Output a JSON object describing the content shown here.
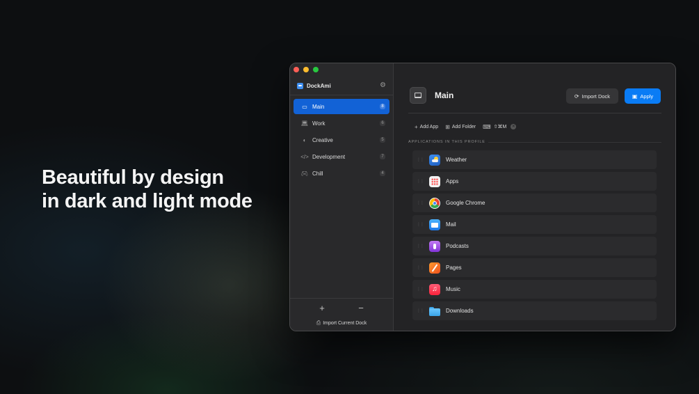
{
  "headline": {
    "line1": "Beautiful by design",
    "line2": "in dark and light mode"
  },
  "app": {
    "name": "DockAmi",
    "settings_icon": "gear-icon"
  },
  "sidebar": {
    "profiles": [
      {
        "label": "Main",
        "count": "8",
        "icon": "dock-icon",
        "active": true
      },
      {
        "label": "Work",
        "count": "6",
        "icon": "laptop-icon",
        "active": false
      },
      {
        "label": "Creative",
        "count": "5",
        "icon": "palette-icon",
        "active": false
      },
      {
        "label": "Development",
        "count": "7",
        "icon": "code-icon",
        "active": false
      },
      {
        "label": "Chill",
        "count": "4",
        "icon": "gamepad-icon",
        "active": false
      }
    ],
    "add_symbol": "+",
    "remove_symbol": "−",
    "import_current_dock": "Import Current Dock"
  },
  "main": {
    "title": "Main",
    "import_dock_label": "Import Dock",
    "apply_label": "Apply",
    "add_app_label": "Add App",
    "add_folder_label": "Add Folder",
    "shortcut": "⇧⌘M",
    "section_label": "APPLICATIONS IN THIS PROFILE",
    "apps": [
      {
        "name": "Weather",
        "icon": "weather-icon"
      },
      {
        "name": "Apps",
        "icon": "apps-icon"
      },
      {
        "name": "Google Chrome",
        "icon": "chrome-icon"
      },
      {
        "name": "Mail",
        "icon": "mail-icon"
      },
      {
        "name": "Podcasts",
        "icon": "podcasts-icon"
      },
      {
        "name": "Pages",
        "icon": "pages-icon"
      },
      {
        "name": "Music",
        "icon": "music-icon"
      },
      {
        "name": "Downloads",
        "icon": "downloads-folder-icon"
      }
    ]
  },
  "colors": {
    "accent": "#0a7cf5",
    "selected": "#1262d6",
    "window_bg": "#222324"
  }
}
